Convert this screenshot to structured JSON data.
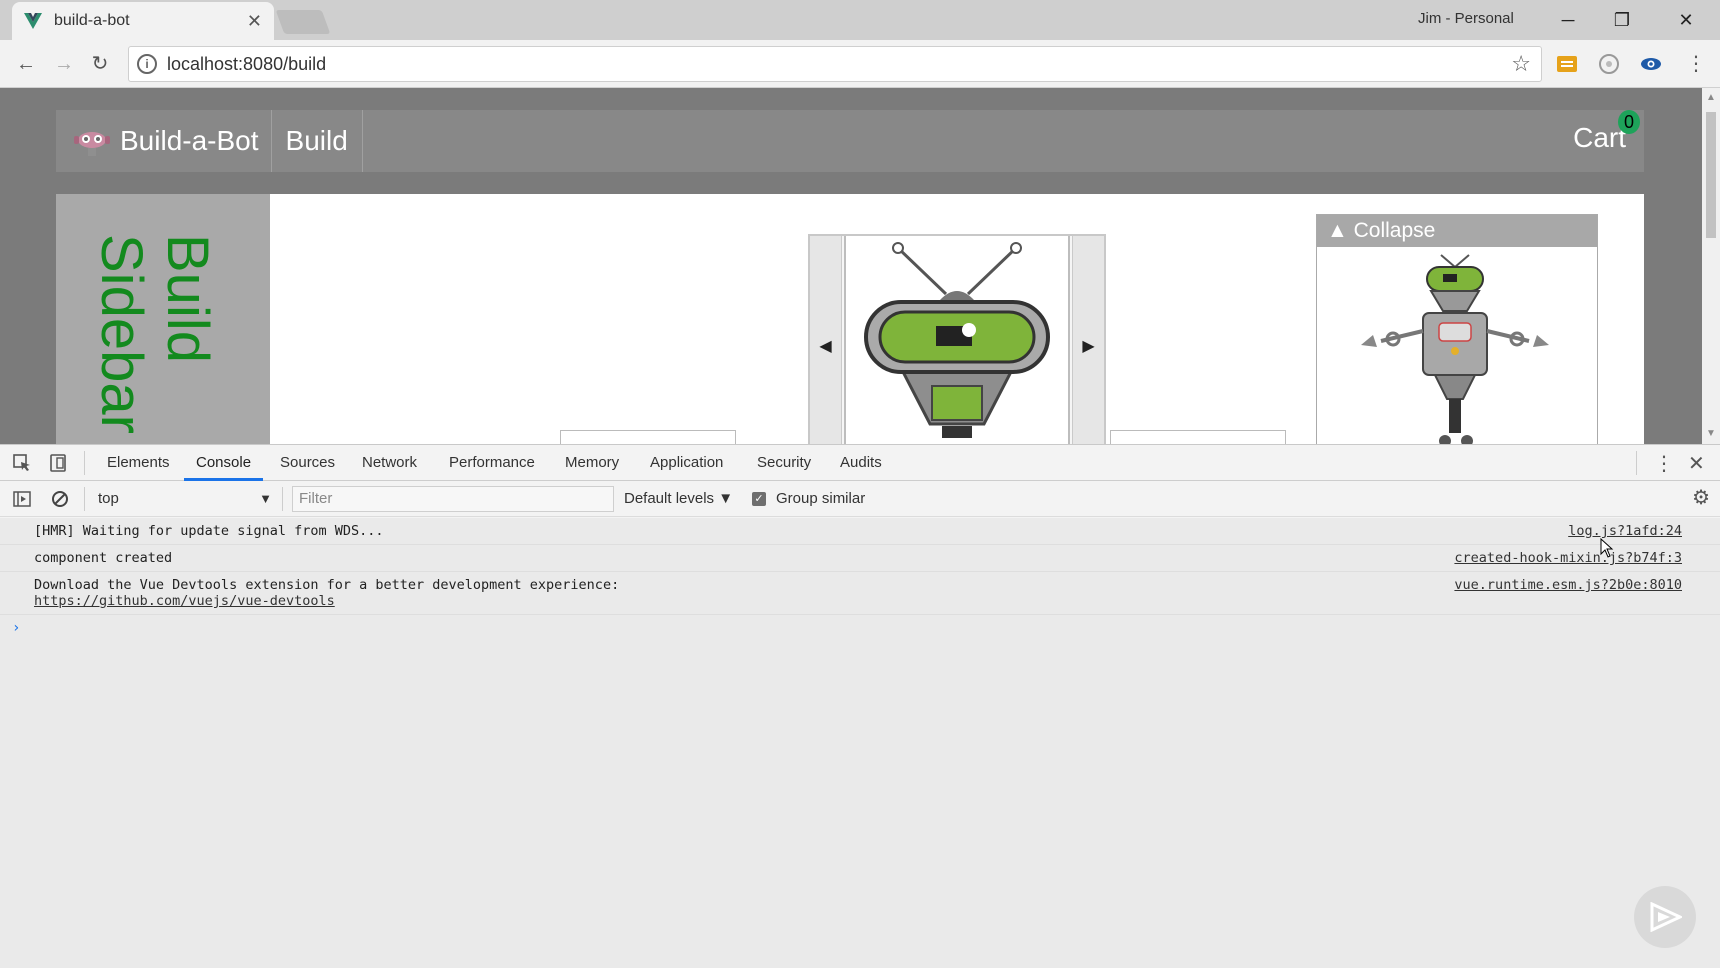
{
  "browser": {
    "tab_title": "build-a-bot",
    "profile": "Jim - Personal",
    "url": "localhost:8080/build"
  },
  "app": {
    "brand": "Build-a-Bot",
    "nav_build": "Build",
    "cart_label": "Cart",
    "cart_count": "0",
    "sidebar_text": "Build Sidebar",
    "collapse_label": "Collapse"
  },
  "devtools": {
    "tabs": [
      "Elements",
      "Console",
      "Sources",
      "Network",
      "Performance",
      "Memory",
      "Application",
      "Security",
      "Audits"
    ],
    "active_tab": "Console",
    "context": "top",
    "filter_placeholder": "Filter",
    "levels": "Default levels",
    "group_similar": "Group similar",
    "messages": [
      {
        "text": "[HMR] Waiting for update signal from WDS...",
        "source": "log.js?1afd:24"
      },
      {
        "text": "component created",
        "source": "created-hook-mixin.js?b74f:3"
      },
      {
        "text": "Download the Vue Devtools extension for a better development experience:",
        "link": "https://github.com/vuejs/vue-devtools",
        "source": "vue.runtime.esm.js?2b0e:8010"
      }
    ]
  },
  "colors": {
    "accent": "#1a73e8",
    "sidebar_text": "#138a1e",
    "badge": "#1ea35a"
  }
}
